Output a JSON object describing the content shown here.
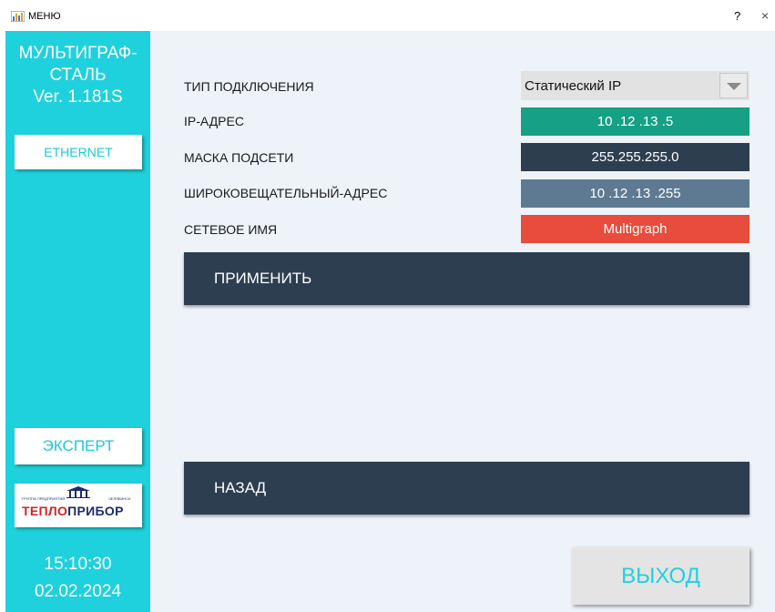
{
  "window": {
    "title": "МЕНЮ",
    "help_label": "?",
    "close_label": "×"
  },
  "sidebar": {
    "brand_line1": "МУЛЬТИГРАФ-",
    "brand_line2": "СТАЛЬ",
    "version": "Ver. 1.181S",
    "ethernet_label": "ETHERNET",
    "expert_label": "ЭКСПЕРТ",
    "logo": {
      "text_left": "ГРУППА ПРЕДПРИЯТИЙ",
      "text_right": "ЧЕЛЯБИНСК",
      "word_red": "ТЕПЛО",
      "word_blue": "ПРИБОР",
      "red_color": "#d52229",
      "blue_color": "#1a2c6c"
    },
    "time": "15:10:30",
    "date": "02.02.2024"
  },
  "main": {
    "connection_type_label": "ТИП ПОДКЛЮЧЕНИЯ",
    "connection_type_value": "Статический IP",
    "ip_label": "IP-АДРЕС",
    "ip_value": "10 .12 .13 .5",
    "mask_label": "МАСКА ПОДСЕТИ",
    "mask_value": "255.255.255.0",
    "broadcast_label": "ШИРОКОВЕЩАТЕЛЬНЫЙ-АДРЕС",
    "broadcast_value": "10 .12 .13 .255",
    "hostname_label": "СЕТЕВОЕ ИМЯ",
    "hostname_value": "Multigraph",
    "apply_label": "ПРИМЕНИТЬ",
    "back_label": "НАЗАД",
    "exit_label": "ВЫХОД"
  },
  "colors": {
    "sidebar": "#1fd1dc",
    "main_bg": "#eef3f9",
    "ip": "#16a085",
    "mask": "#2c3e50",
    "broadcast": "#5d7a92",
    "hostname": "#e74c3c",
    "dark_button": "#2c3e50"
  },
  "icons": {
    "app": "chart-app-icon",
    "dropdown": "chevron-down-icon"
  }
}
